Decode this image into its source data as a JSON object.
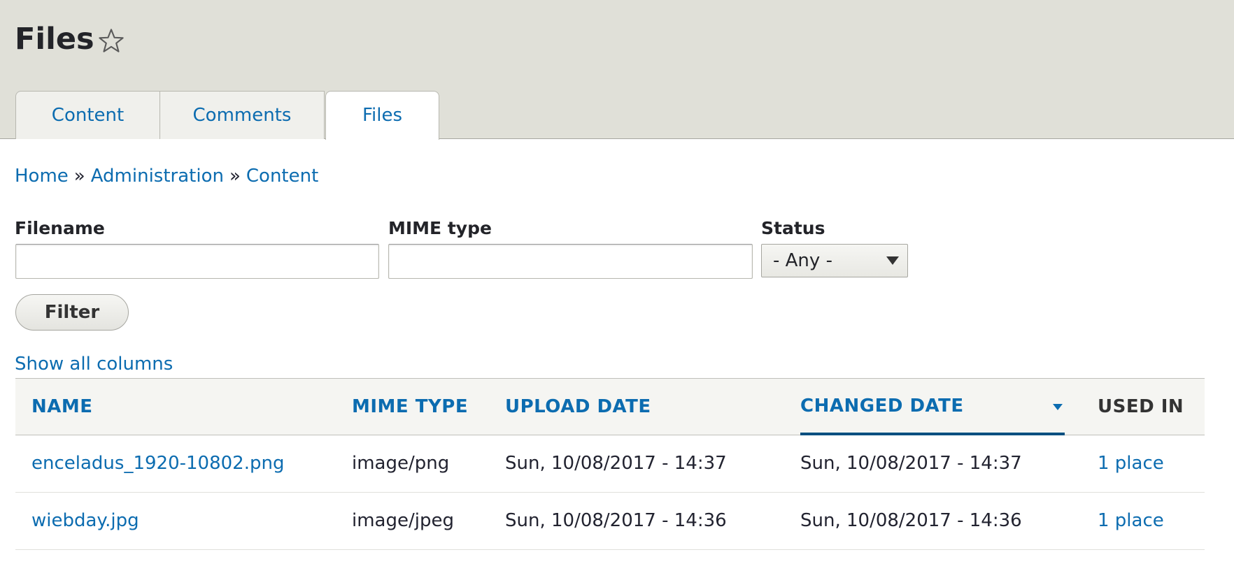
{
  "header": {
    "title": "Files",
    "favorite_icon": "star-outline-icon",
    "tabs": [
      {
        "label": "Content",
        "active": false
      },
      {
        "label": "Comments",
        "active": false
      },
      {
        "label": "Files",
        "active": true
      }
    ]
  },
  "breadcrumb": [
    {
      "label": "Home"
    },
    {
      "label": "Administration"
    },
    {
      "label": "Content"
    }
  ],
  "breadcrumb_separator": "»",
  "filters": {
    "filename": {
      "label": "Filename",
      "value": ""
    },
    "mime_type": {
      "label": "MIME type",
      "value": ""
    },
    "status": {
      "label": "Status",
      "selected": "- Any -"
    },
    "submit_label": "Filter"
  },
  "show_all_columns": "Show all columns",
  "table": {
    "columns": [
      {
        "label": "NAME",
        "sortable": true
      },
      {
        "label": "MIME TYPE",
        "sortable": true
      },
      {
        "label": "UPLOAD DATE",
        "sortable": true
      },
      {
        "label": "CHANGED DATE",
        "sortable": true,
        "active_sort": "descending"
      },
      {
        "label": "USED IN",
        "sortable": false
      }
    ],
    "rows": [
      {
        "name": "enceladus_1920-10802.png",
        "mime": "image/png",
        "upload": "Sun, 10/08/2017 - 14:37",
        "changed": "Sun, 10/08/2017 - 14:37",
        "used_in": "1 place"
      },
      {
        "name": "wiebday.jpg",
        "mime": "image/jpeg",
        "upload": "Sun, 10/08/2017 - 14:36",
        "changed": "Sun, 10/08/2017 - 14:36",
        "used_in": "1 place"
      }
    ]
  },
  "colors": {
    "link": "#0c6cb0",
    "header_bg": "#e0e0d8",
    "active_sort_underline": "#004f80"
  }
}
